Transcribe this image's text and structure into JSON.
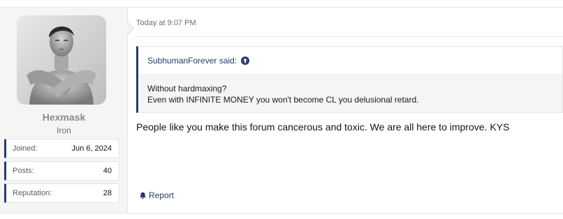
{
  "user": {
    "name": "Hexmask",
    "title": "Iron",
    "avatar_icon": "user-avatar-photo",
    "stats": [
      {
        "label": "Joined:",
        "value": "Jun 6, 2024"
      },
      {
        "label": "Posts:",
        "value": "40"
      },
      {
        "label": "Reputation:",
        "value": "28"
      }
    ]
  },
  "post": {
    "date": "Today at 9:07 PM",
    "quote": {
      "author": "SubhumanForever said:",
      "lines": [
        "Without hardmaxing?",
        "Even with INFINITE MONEY you won't become CL you delusional retard."
      ]
    },
    "message": "People like you make this forum cancerous and toxic. We are all here to improve. KYS",
    "report_label": "Report"
  },
  "colors": {
    "accent": "#283a6b",
    "sidebar_bg": "#f5f5f5",
    "quote_bg": "#f5f5f5"
  }
}
